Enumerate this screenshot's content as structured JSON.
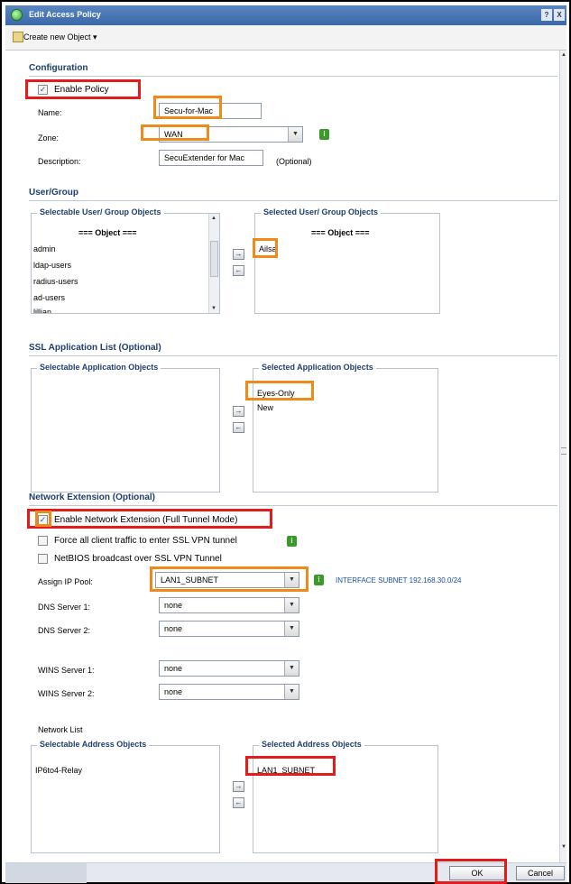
{
  "window": {
    "title": "Edit Access Policy",
    "help_label": "?",
    "close_label": "X"
  },
  "toolbar": {
    "create_label": "Create new Object ▾"
  },
  "configuration": {
    "section_title": "Configuration",
    "enable_policy_label": "Enable Policy",
    "enable_policy_checked": true,
    "name_label": "Name:",
    "name_value": "Secu-for-Mac",
    "zone_label": "Zone:",
    "zone_value": "WAN",
    "description_label": "Description:",
    "description_value": "SecuExtender for Mac",
    "optional_label": "(Optional)"
  },
  "user_group": {
    "section_title": "User/Group",
    "selectable_title": "Selectable User/ Group Objects",
    "selectable_header": "=== Object ===",
    "selectable_items": [
      "admin",
      "ldap-users",
      "radius-users",
      "ad-users",
      "lillian"
    ],
    "selected_title": "Selected User/ Group Objects",
    "selected_header": "=== Object ===",
    "selected_items": [
      "Ailsa"
    ]
  },
  "ssl_app": {
    "section_title": "SSL Application List (Optional)",
    "selectable_title": "Selectable Application Objects",
    "selected_title": "Selected Application Objects",
    "selected_items": [
      "Eyes-Only",
      "New"
    ]
  },
  "network_ext": {
    "section_title": "Network Extension (Optional)",
    "enable_label": "Enable Network Extension (Full Tunnel Mode)",
    "enable_checked": true,
    "force_label": "Force all client traffic to enter SSL VPN tunnel",
    "force_checked": false,
    "netbios_label": "NetBIOS broadcast over SSL VPN Tunnel",
    "netbios_checked": false,
    "ip_pool_label": "Assign IP Pool:",
    "ip_pool_value": "LAN1_SUBNET",
    "interface_link": "INTERFACE SUBNET 192.168.30.0/24",
    "dns1_label": "DNS Server 1:",
    "dns1_value": "none",
    "dns2_label": "DNS Server 2:",
    "dns2_value": "none",
    "wins1_label": "WINS Server 1:",
    "wins1_value": "none",
    "wins2_label": "WINS Server 2:",
    "wins2_value": "none",
    "network_list_label": "Network List",
    "selectable_title": "Selectable Address Objects",
    "selectable_items": [
      "IP6to4-Relay"
    ],
    "selected_title": "Selected Address Objects",
    "selected_items": [
      "LAN1_SUBNET"
    ]
  },
  "buttons": {
    "ok_label": "OK",
    "cancel_label": "Cancel"
  },
  "colors": {
    "highlight_orange": "#ef8a1a",
    "highlight_red": "#e21b1b",
    "section_blue": "#1e3f6e",
    "titlebar_blue": "#3a68a8"
  }
}
